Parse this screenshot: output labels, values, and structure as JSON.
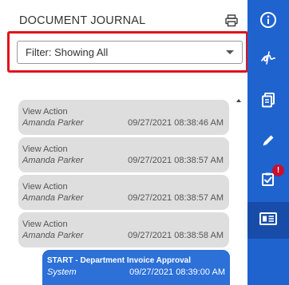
{
  "journal": {
    "title": "DOCUMENT JOURNAL",
    "filter": {
      "value": "Filter: Showing All"
    },
    "entries": [
      {
        "action": "View Action",
        "user": "Amanda Parker",
        "timestamp": "09/27/2021 08:38:46 AM"
      },
      {
        "action": "View Action",
        "user": "Amanda Parker",
        "timestamp": "09/27/2021 08:38:57 AM"
      },
      {
        "action": "View Action",
        "user": "Amanda Parker",
        "timestamp": "09/27/2021 08:38:57 AM"
      },
      {
        "action": "View Action",
        "user": "Amanda Parker",
        "timestamp": "09/27/2021 08:38:58 AM"
      }
    ],
    "active_entry": {
      "action": "START - Department Invoice Approval",
      "user": "System",
      "timestamp": "09/27/2021 08:39:00 AM"
    }
  },
  "sidebar": {
    "buttons": [
      {
        "icon": "info-icon"
      },
      {
        "icon": "signature-icon"
      },
      {
        "icon": "copy-document-icon"
      },
      {
        "icon": "pencil-icon"
      },
      {
        "icon": "task-checklist-icon",
        "badge": "!"
      },
      {
        "icon": "journal-icon",
        "active": true
      }
    ]
  },
  "colors": {
    "accent": "#1f63cf",
    "active_entry": "#2c70d8",
    "highlight_outline": "#e0131a",
    "badge": "#c8102e"
  }
}
